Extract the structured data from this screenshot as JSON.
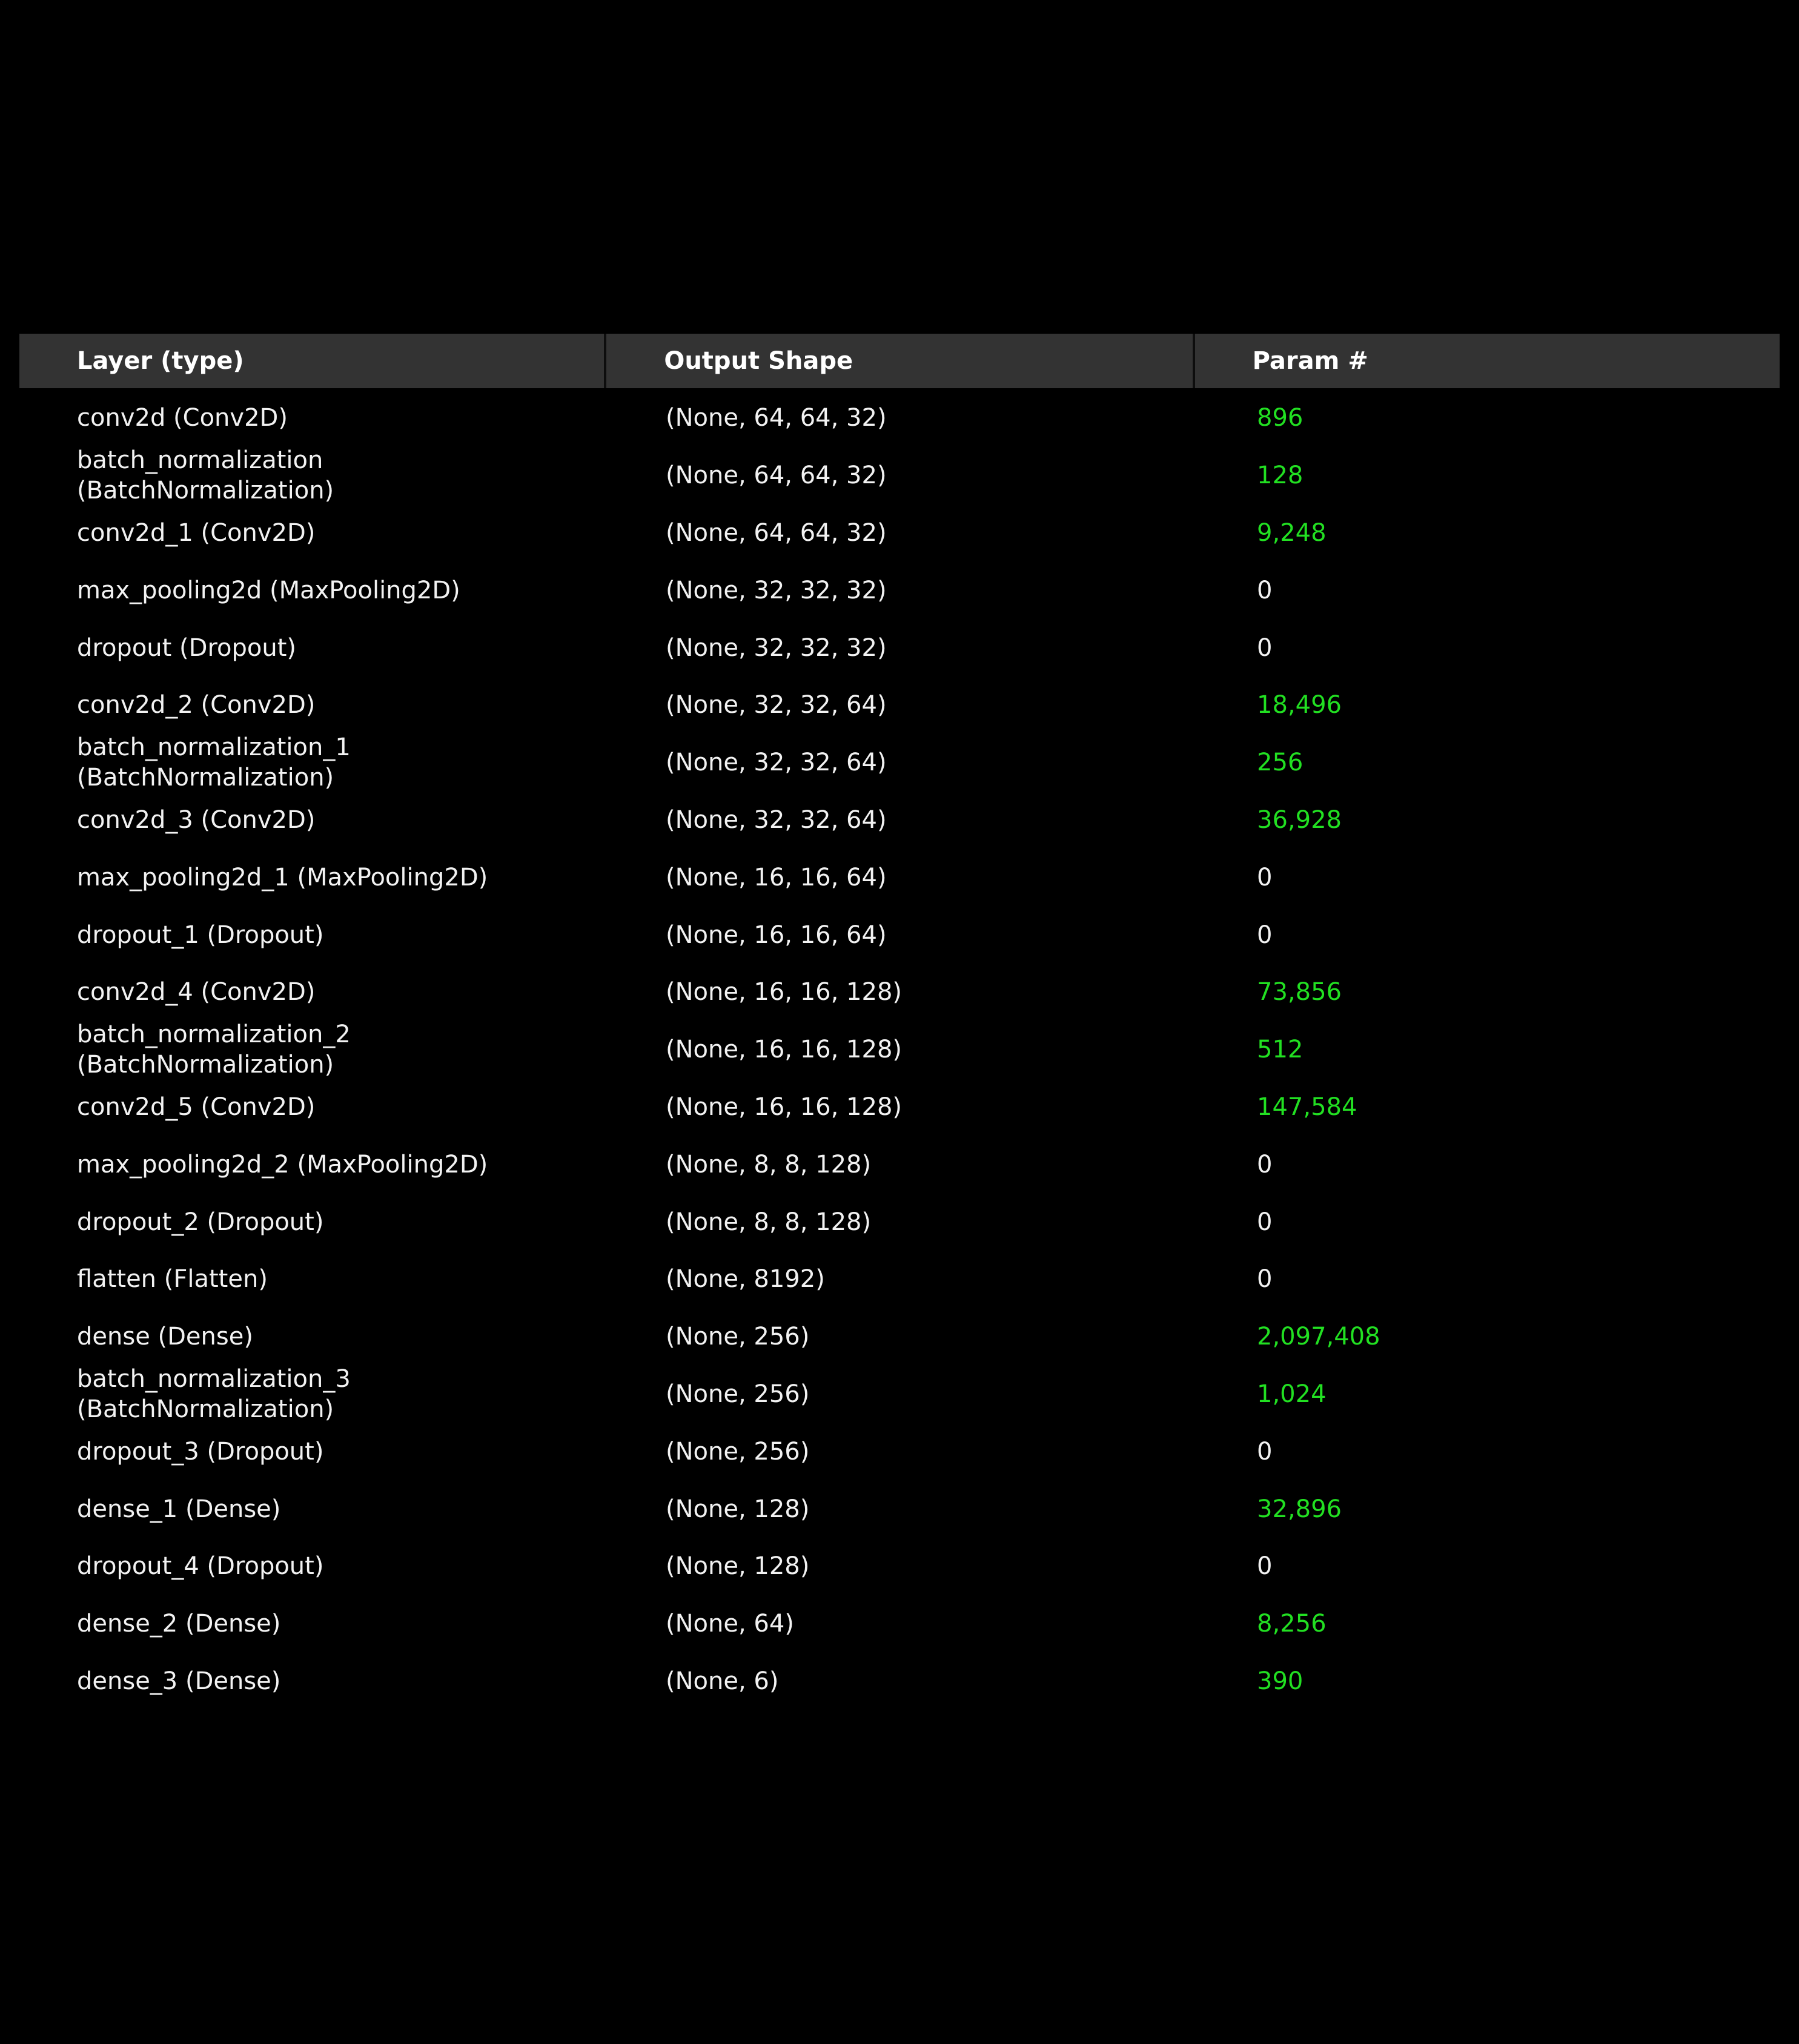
{
  "table": {
    "headers": [
      "Layer (type)",
      "Output Shape",
      "Param #"
    ],
    "rows": [
      {
        "layer": "conv2d (Conv2D)",
        "shape": "(None, 64, 64, 32)",
        "params": "896"
      },
      {
        "layer": "batch_normalization\n(BatchNormalization)",
        "shape": "(None, 64, 64, 32)",
        "params": "128"
      },
      {
        "layer": "conv2d_1 (Conv2D)",
        "shape": "(None, 64, 64, 32)",
        "params": "9,248"
      },
      {
        "layer": "max_pooling2d (MaxPooling2D)",
        "shape": "(None, 32, 32, 32)",
        "params": "0"
      },
      {
        "layer": "dropout (Dropout)",
        "shape": "(None, 32, 32, 32)",
        "params": "0"
      },
      {
        "layer": "conv2d_2 (Conv2D)",
        "shape": "(None, 32, 32, 64)",
        "params": "18,496"
      },
      {
        "layer": "batch_normalization_1\n(BatchNormalization)",
        "shape": "(None, 32, 32, 64)",
        "params": "256"
      },
      {
        "layer": "conv2d_3 (Conv2D)",
        "shape": "(None, 32, 32, 64)",
        "params": "36,928"
      },
      {
        "layer": "max_pooling2d_1 (MaxPooling2D)",
        "shape": "(None, 16, 16, 64)",
        "params": "0"
      },
      {
        "layer": "dropout_1 (Dropout)",
        "shape": "(None, 16, 16, 64)",
        "params": "0"
      },
      {
        "layer": "conv2d_4 (Conv2D)",
        "shape": "(None, 16, 16, 128)",
        "params": "73,856"
      },
      {
        "layer": "batch_normalization_2\n(BatchNormalization)",
        "shape": "(None, 16, 16, 128)",
        "params": "512"
      },
      {
        "layer": "conv2d_5 (Conv2D)",
        "shape": "(None, 16, 16, 128)",
        "params": "147,584"
      },
      {
        "layer": "max_pooling2d_2 (MaxPooling2D)",
        "shape": "(None, 8, 8, 128)",
        "params": "0"
      },
      {
        "layer": "dropout_2 (Dropout)",
        "shape": "(None, 8, 8, 128)",
        "params": "0"
      },
      {
        "layer": "flatten (Flatten)",
        "shape": "(None, 8192)",
        "params": "0"
      },
      {
        "layer": "dense (Dense)",
        "shape": "(None, 256)",
        "params": "2,097,408"
      },
      {
        "layer": "batch_normalization_3\n(BatchNormalization)",
        "shape": "(None, 256)",
        "params": "1,024"
      },
      {
        "layer": "dropout_3 (Dropout)",
        "shape": "(None, 256)",
        "params": "0"
      },
      {
        "layer": "dense_1 (Dense)",
        "shape": "(None, 128)",
        "params": "32,896"
      },
      {
        "layer": "dropout_4 (Dropout)",
        "shape": "(None, 128)",
        "params": "0"
      },
      {
        "layer": "dense_2 (Dense)",
        "shape": "(None, 64)",
        "params": "8,256"
      },
      {
        "layer": "dense_3 (Dense)",
        "shape": "(None, 6)",
        "params": "390"
      }
    ]
  },
  "colors": {
    "background": "#000000",
    "header_background": "#333333",
    "text": "#f2f2f2",
    "param_nonzero": "#22e022"
  }
}
